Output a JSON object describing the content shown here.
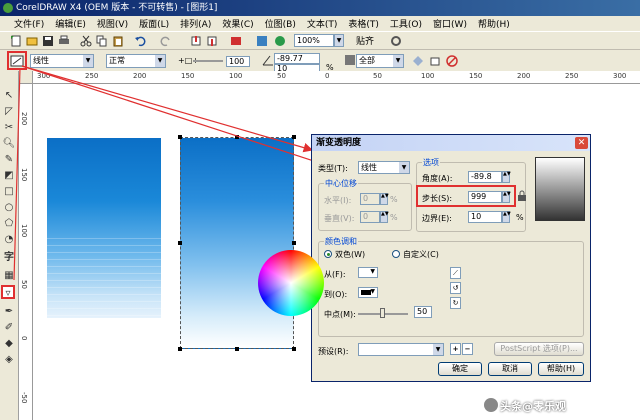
{
  "app": {
    "title": "CorelDRAW X4 (OEM 版本 - 不可转售) - [图形1]"
  },
  "menu": [
    "文件(F)",
    "编辑(E)",
    "视图(V)",
    "版面(L)",
    "排列(A)",
    "效果(C)",
    "位图(B)",
    "文本(T)",
    "表格(T)",
    "工具(O)",
    "窗口(W)",
    "帮助(H)"
  ],
  "toolbar": {
    "zoom": "100%",
    "snap": "贴齐"
  },
  "propbar": {
    "type_value": "线性",
    "mode_value": "正常",
    "midpoint_value": "100",
    "angle_value": "-89.77",
    "edge_value": "10",
    "percent": "%",
    "target_value": "全部"
  },
  "rulers": {
    "top_labels": [
      "300",
      "250",
      "200",
      "150",
      "100",
      "50",
      "0",
      "50",
      "100",
      "150",
      "200",
      "250",
      "300"
    ],
    "left_labels": [
      "200",
      "150",
      "100",
      "50",
      "0",
      "-50"
    ]
  },
  "toolbox": {
    "text_tool_glyph": "字"
  },
  "dialog": {
    "title": "渐变透明度",
    "close": "✕",
    "type_label": "类型(T):",
    "type_value": "线性",
    "center_group": "中心位移",
    "horizontal_label": "水平(I):",
    "horizontal_value": "0",
    "vertical_label": "垂直(V):",
    "vertical_value": "0",
    "options_group": "选项",
    "angle_label": "角度(A):",
    "angle_value": "-89.8",
    "steps_label": "步长(S):",
    "steps_value": "999",
    "edge_label": "边界(E):",
    "edge_value": "10",
    "percent": "%",
    "color_group": "颜色调和",
    "two_color_label": "双色(W)",
    "custom_label": "自定义(C)",
    "from_label": "从(F):",
    "to_label": "到(O):",
    "midpoint_label": "中点(M):",
    "midpoint_value": "50",
    "preset_label": "预设(R):",
    "postscript_label": "PostScript 选项(P)...",
    "ok_label": "确定",
    "cancel_label": "取消",
    "help_label": "帮助(H)"
  },
  "watermark": "头条@零乐观"
}
